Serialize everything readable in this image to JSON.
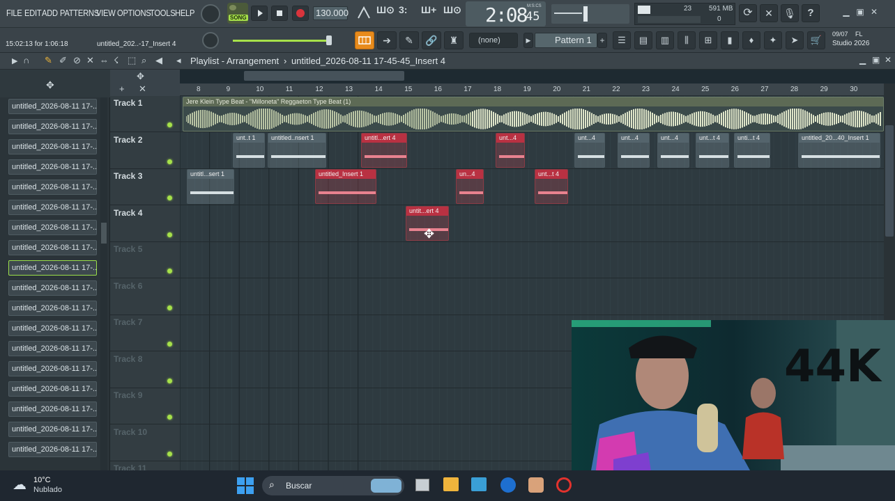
{
  "menu": [
    "FILE",
    "EDIT",
    "ADD",
    "PATTERNS",
    "VIEW",
    "OPTIONS",
    "TOOLS",
    "HELP"
  ],
  "transport": {
    "song_mode": "SONG",
    "tempo": "130.000",
    "time": "2:08",
    "time_sub": "45",
    "time_unit": "M:S:CS",
    "cpu": "23",
    "mem": "591 MB",
    "voices": "0"
  },
  "hint": {
    "time_range": "15:02:13 for 1:06:18",
    "insert": "untitled_202..-17_Insert 4"
  },
  "channel_select": "(none)",
  "pattern": "Pattern 1",
  "fl_info": {
    "date": "09/07",
    "name": "FL",
    "product": "Studio 2026"
  },
  "playlist": {
    "title": "Playlist - Arrangement",
    "path": "untitled_2026-08-11 17-45-45_Insert 4"
  },
  "browser_items": [
    "untitled_2026-08-11 17-...",
    "untitled_2026-08-11 17-...",
    "untitled_2026-08-11 17-...",
    "untitled_2026-08-11 17-...",
    "untitled_2026-08-11 17-...",
    "untitled_2026-08-11 17-...",
    "untitled_2026-08-11 17-...",
    "untitled_2026-08-11 17-...",
    "untitled_2026-08-11 17-...",
    "untitled_2026-08-11 17-...",
    "untitled_2026-08-11 17-...",
    "untitled_2026-08-11 17-...",
    "untitled_2026-08-11 17-...",
    "untitled_2026-08-11 17-...",
    "untitled_2026-08-11 17-...",
    "untitled_2026-08-11 17-...",
    "untitled_2026-08-11 17-...",
    "untitled_2026-08-11 17-..."
  ],
  "ruler": [
    "8",
    "9",
    "10",
    "11",
    "12",
    "13",
    "14",
    "15",
    "16",
    "17",
    "18",
    "19",
    "20",
    "21",
    "22",
    "23",
    "24",
    "25",
    "26",
    "27",
    "28",
    "29",
    "30"
  ],
  "tracks": [
    "Track 1",
    "Track 2",
    "Track 3",
    "Track 4",
    "Track 5",
    "Track 6",
    "Track 7",
    "Track 8",
    "Track 9",
    "Track 10",
    "Track 11"
  ],
  "clips": {
    "t1": "Jere Klein Type Beat - \"Milloneta\" Reggaeton Type Beat (1)",
    "t2a": "unt..t 1",
    "t2b": "untitled..nsert 1",
    "t2c": "untitl...ert 4",
    "t2d": "unt...4",
    "t2e": "unt...4",
    "t2f": "unt...4",
    "t2g": "unt...4",
    "t2h": "unt...t 4",
    "t2i": "unti...t 4",
    "t2j": "untitled_20...40_Insert 1",
    "t3a": "untitl...sert 1",
    "t3b": "untitled_Insert 1",
    "t3c": "un...4",
    "t3d": "unt...t 4",
    "t4a": "untit...ert 4"
  },
  "weather": {
    "temp": "10°C",
    "desc": "Nublado"
  },
  "search_placeholder": "Buscar",
  "webcam_overlay": "44K",
  "colors": {
    "accent": "#e88b1c",
    "clip_red": "#b93142",
    "led": "#a6e14a",
    "select": "#9be04a"
  }
}
